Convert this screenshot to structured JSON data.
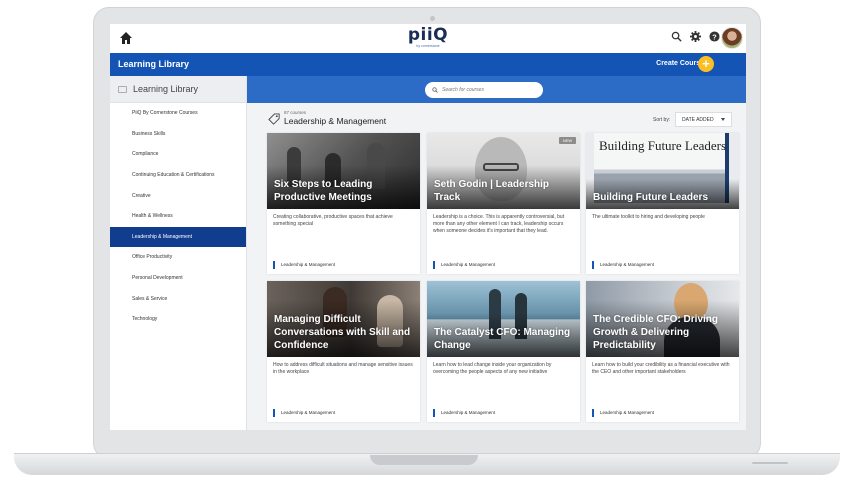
{
  "app": {
    "logo_text": "piiQ",
    "logo_subtext": "by cornerstone"
  },
  "header": {
    "section_title": "Learning Library",
    "create_label": "Create Course",
    "create_icon": "plus-icon"
  },
  "search": {
    "placeholder": "Search for courses"
  },
  "sidebar": {
    "title": "Learning Library",
    "items": [
      {
        "label": "PiiQ By Cornerstone Courses"
      },
      {
        "label": "Business Skills"
      },
      {
        "label": "Compliance"
      },
      {
        "label": "Continuing Education & Certifications"
      },
      {
        "label": "Creative"
      },
      {
        "label": "Health & Wellness"
      },
      {
        "label": "Leadership & Management",
        "active": true
      },
      {
        "label": "Office Productivity"
      },
      {
        "label": "Personal Development"
      },
      {
        "label": "Sales & Service"
      },
      {
        "label": "Technology"
      }
    ]
  },
  "collection": {
    "count": "87 courses",
    "title": "Leadership & Management",
    "sort_label": "Sort by:",
    "sort_value": "DATE ADDED"
  },
  "cards": [
    {
      "title": "Six Steps to Leading Productive Meetings",
      "desc": "Creating collaborative, productive spaces that achieve something special",
      "category": "Leadership & Management"
    },
    {
      "title": "Seth Godin | Leadership Track",
      "badge": "NEW",
      "desc": "Leadership is a choice. This is apparently controversial, but more than any other element I can track, leadership occurs when someone decides it's important that they lead.",
      "category": "Leadership & Management"
    },
    {
      "title": "Building Future Leaders",
      "image_text": "Building Future Leaders",
      "desc": "The ultimate toolkit to hiring and developing people",
      "category": "Leadership & Management"
    },
    {
      "title": "Managing Difficult Conversations with Skill and Confidence",
      "desc": "How to address difficult situations and manage sensitive issues in the workplace",
      "category": "Leadership & Management"
    },
    {
      "title": "The Catalyst CFO: Managing Change",
      "desc": "Learn how to lead change inside your organization by overcoming the people aspects of any new initiative",
      "category": "Leadership & Management"
    },
    {
      "title": "The Credible CFO: Driving Growth & Delivering Predictability",
      "desc": "Learn how to build your credibility as a financial executive with the CEO and other important stakeholders",
      "category": "Leadership & Management"
    }
  ],
  "colors": {
    "primary_blue": "#1354b5",
    "search_band": "#2d6cc6",
    "active_nav": "#113d8f",
    "accent_yellow": "#fbbf24",
    "new_badge": "#3fa85a"
  }
}
